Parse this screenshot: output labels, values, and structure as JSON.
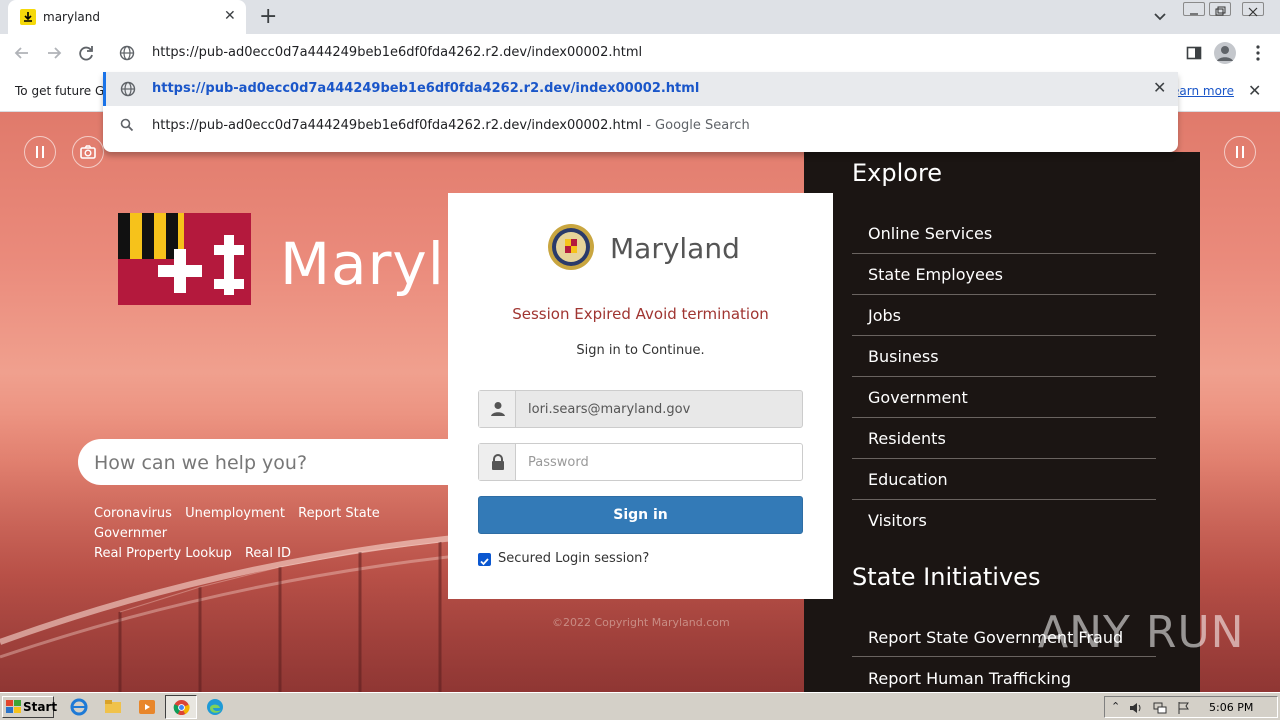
{
  "browser": {
    "tab_title": "maryland",
    "address_text": "https://pub-ad0ecc0d7a444249beb1e6df0fda4262.r2.dev/index00002.html",
    "suggestion_url": "https://pub-ad0ecc0d7a444249beb1e6df0fda4262.r2.dev/index00002.html",
    "search_suggestion_query": "https://pub-ad0ecc0d7a444249beb1e6df0fda4262.r2.dev/index00002.html",
    "search_suggestion_suffix": " - Google Search",
    "infobar_message": "To get future G",
    "infobar_link": "earn more"
  },
  "hero": {
    "wordmark": "Maryl",
    "search_placeholder": "How can we help you?",
    "quick_links": [
      "Coronavirus",
      "Unemployment",
      "Report State Governmer",
      "Real Property Lookup",
      "Real ID"
    ]
  },
  "explore": {
    "title": "Explore",
    "items": [
      "Online Services",
      "State Employees",
      "Jobs",
      "Business",
      "Government",
      "Residents",
      "Education",
      "Visitors"
    ],
    "initiatives_title": "State Initiatives",
    "initiatives": [
      "Report State Government Fraud",
      "Report Human Trafficking"
    ]
  },
  "login": {
    "brand": "Maryland",
    "warning": "Session Expired Avoid termination",
    "subtitle": "Sign in to Continue.",
    "email_value": "lori.sears@maryland.gov",
    "password_placeholder": "Password",
    "signin_label": "Sign in",
    "remember_label": "Secured Login session?",
    "remember_checked": true
  },
  "footer": {
    "copyright": "©2022 Copyright Maryland.com",
    "watermark": "ANY RUN"
  },
  "taskbar": {
    "start_label": "Start",
    "clock": "5:06 PM"
  },
  "colors": {
    "signin_button": "#337ab7",
    "warning_text": "#a03531",
    "explore_panel": "#1b1513",
    "link_blue": "#1a56c9"
  }
}
